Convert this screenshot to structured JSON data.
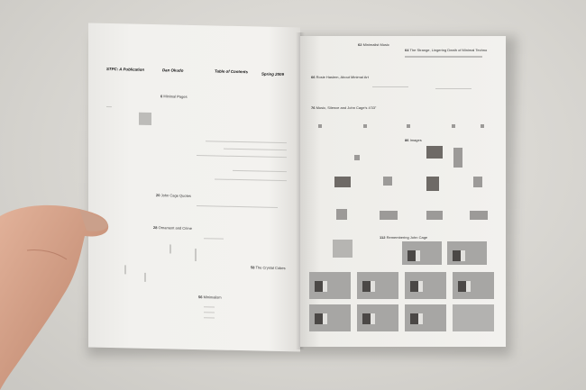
{
  "left_page": {
    "header": {
      "pub": "STPC: A Publication",
      "author": "Dan Okudo",
      "toc": "Table of Contents",
      "date": "Spring 2009"
    },
    "entries": [
      {
        "num": "6",
        "title": "Minimal Pages"
      },
      {
        "num": "20",
        "title": "John Cage Quotes"
      },
      {
        "num": "28",
        "title": "Ornament and Crime"
      },
      {
        "num": "58",
        "title": "The Crystal Cubes"
      },
      {
        "num": "56",
        "title": "Minimalism"
      }
    ]
  },
  "right_page": {
    "entries": [
      {
        "num": "62",
        "title": "Minimalist Music"
      },
      {
        "num": "64",
        "title": "The Strange, Lingering Death of Minimal Techno"
      },
      {
        "num": "66",
        "title": "Rosie Haslem, About Minimal Art"
      },
      {
        "num": "76",
        "title": "Music, Silence and John Cage's 4'33\""
      },
      {
        "num": "86",
        "title": "Images"
      },
      {
        "num": "112",
        "title": "Remembering John Cage"
      }
    ]
  },
  "colors": {
    "paper": "#f1f0ed",
    "ink": "#111111",
    "thumb": "#9c9a98",
    "skin": "#d8a48a"
  }
}
